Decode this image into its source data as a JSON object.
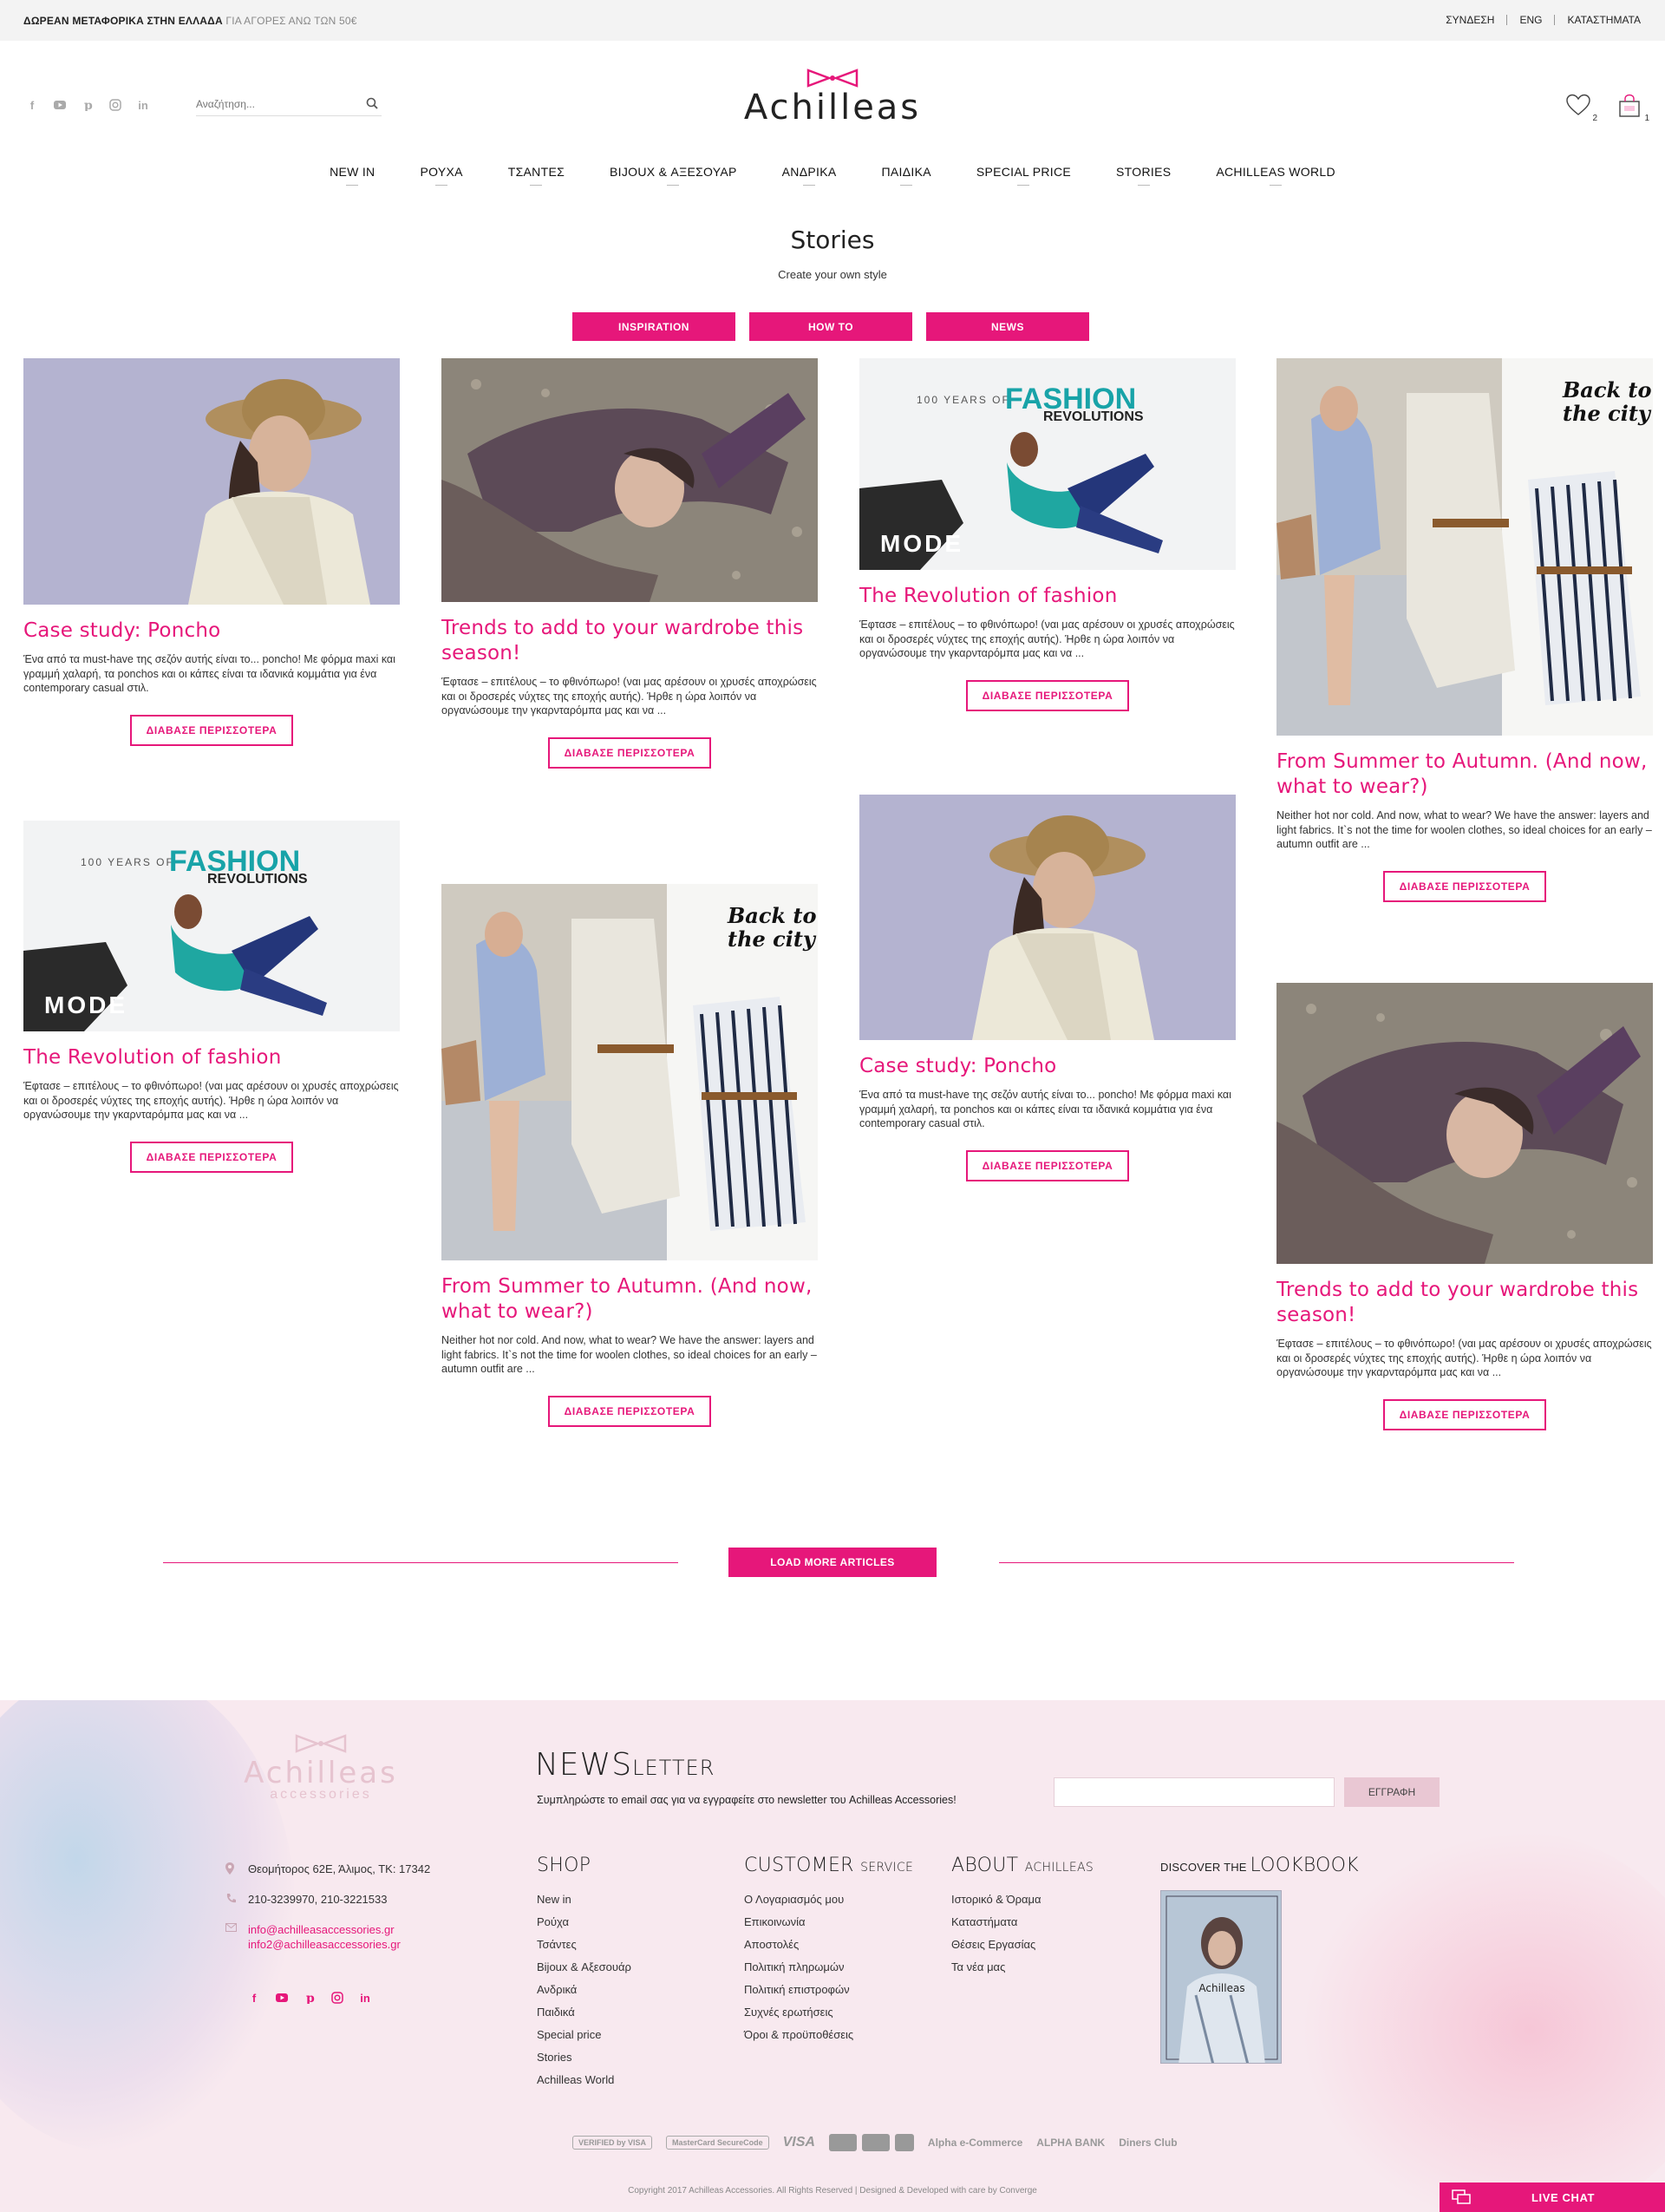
{
  "topbar": {
    "promo_bold": "ΔΩΡΕΑΝ ΜΕΤΑΦΟΡΙΚΑ ΣΤΗΝ ΕΛΛΑΔΑ",
    "promo_light": "ΓΙΑ ΑΓΟΡΕΣ ΑΝΩ ΤΩΝ 50€",
    "links": [
      "ΣΥΝΔΕΣΗ",
      "ENG",
      "ΚΑΤΑΣΤΗΜΑΤΑ"
    ]
  },
  "header": {
    "search_placeholder": "Αναζήτηση...",
    "logo_text": "Achilleas",
    "wishlist_count": "2",
    "cart_count": "1"
  },
  "nav": [
    "NEW IN",
    "ΡΟΥΧΑ",
    "ΤΣΑΝΤΕΣ",
    "BIJOUX & ΑΞΕΣΟΥΑΡ",
    "ΑΝΔΡΙΚΑ",
    "ΠΑΙΔΙΚΑ",
    "SPECIAL PRICE",
    "STORIES",
    "ACHILLEAS WORLD"
  ],
  "stories": {
    "title": "Stories",
    "subtitle": "Create your own style",
    "filters": [
      "INSPIRATION",
      "HOW TO",
      "NEWS"
    ],
    "read_more": "ΔΙΑΒΑΣΕ ΠΕΡΙΣΣΟΤΕΡΑ",
    "load_more": "LOAD MORE ARTICLES"
  },
  "articles": [
    {
      "title": "Case study: Poncho",
      "text": "Ένα από τα must-have της σεζόν αυτής είναι το... poncho! Με φόρμα maxi και γραμμή χαλαρή, τα ponchos και οι κάπες είναι τα ιδανικά κομμάτια για ένα contemporary casual στιλ."
    },
    {
      "title": "Trends to add to your wardrobe this season!",
      "text": "Έφτασε – επιτέλους – το φθινόπωρο! (ναι μας αρέσουν οι χρυσές αποχρώσεις και οι δροσερές νύχτες της εποχής αυτής). Ήρθε η ώρα λοιπόν να οργανώσουμε την γκαρνταρόμπα μας και να ..."
    },
    {
      "title": "The Revolution of fashion",
      "text": "Έφτασε – επιτέλους – το φθινόπωρο! (ναι μας αρέσουν οι χρυσές αποχρώσεις και οι δροσερές νύχτες της εποχής αυτής). Ήρθε η ώρα λοιπόν να οργανώσουμε την γκαρνταρόμπα μας και να ..."
    },
    {
      "title": "From Summer to Autumn. (And now, what to wear?)",
      "text": "Neither hot nor cold. And now, what to wear? We have the answer: layers and light fabrics. It`s not the time for woolen clothes, so ideal choices for an early – autumn outfit are ..."
    },
    {
      "title": "The Revolution of fashion",
      "text": "Έφτασε – επιτέλους – το φθινόπωρο! (ναι μας αρέσουν οι χρυσές αποχρώσεις και οι δροσερές νύχτες της εποχής αυτής). Ήρθε η ώρα λοιπόν να οργανώσουμε την γκαρνταρόμπα μας και να ..."
    },
    {
      "title": "From Summer to Autumn. (And now, what to wear?)",
      "text": "Neither hot nor cold. And now, what to wear? We have the answer: layers and light fabrics. It`s not the time for woolen clothes, so ideal choices for an early – autumn outfit are ..."
    },
    {
      "title": "Case study: Poncho",
      "text": "Ένα από τα must-have της σεζόν αυτής είναι το... poncho! Με φόρμα maxi και γραμμή χαλαρή, τα ponchos και οι κάπες είναι τα ιδανικά κομμάτια για ένα contemporary casual στιλ."
    },
    {
      "title": "Trends to add to your wardrobe this season!",
      "text": "Έφτασε – επιτέλους – το φθινόπωρο! (ναι μας αρέσουν οι χρυσές αποχρώσεις και οι δροσερές νύχτες της εποχής αυτής). Ήρθε η ώρα λοιπόν να οργανώσουμε την γκαρνταρόμπα μας και να ..."
    }
  ],
  "image_text": {
    "mode_line1": "100 YEARS OF",
    "mode_big": "FASHION",
    "mode_big2": "REVOLUTIONS",
    "mode_tag": "MODE",
    "city_line1": "Back to",
    "city_line2": "the city"
  },
  "footer": {
    "logo_word": "Achilleas",
    "logo_sub": "accessories",
    "newsletter_big": "NEWS",
    "newsletter_small": "LETTER",
    "newsletter_text": "Συμπληρώστε το email σας για να εγγραφείτε στο newsletter του Achilleas Accessories!",
    "newsletter_button": "ΕΓΓΡΑΦΗ",
    "address": "Θεομήτορος 62Ε, Άλιμος, ΤΚ: 17342",
    "phones": "210-3239970, 210-3221533",
    "email1": "info@achilleasaccessories.gr",
    "email2": "info2@achilleasaccessories.gr",
    "shop": {
      "title": "SHOP",
      "items": [
        "New in",
        "Ρούχα",
        "Τσάντες",
        "Bijoux & Αξεσουάρ",
        "Ανδρικά",
        "Παιδικά",
        "Special price",
        "Stories",
        "Achilleas World"
      ]
    },
    "customer": {
      "title_big": "CUSTOMER",
      "title_small": "SERVICE",
      "items": [
        "Ο Λογαριασμός μου",
        "Επικοινωνία",
        "Αποστολές",
        "Πολιτική πληρωμών",
        "Πολιτική επιστροφών",
        "Συχνές ερωτήσεις",
        "Όροι & προϋποθέσεις"
      ]
    },
    "about": {
      "title_big": "ABOUT",
      "title_small": "ACHILLEAS",
      "items": [
        "Ιστορικό & Όραμα",
        "Καταστήματα",
        "Θέσεις Εργασίας",
        "Τα νέα μας"
      ]
    },
    "lookbook": {
      "small": "DISCOVER THE",
      "big": "LOOKBOOK",
      "cover_text": "Achilleas"
    },
    "payments": [
      "VERIFIED by VISA",
      "MasterCard SecureCode",
      "VISA",
      "Alpha e-Commerce",
      "ALPHA BANK",
      "Diners Club"
    ],
    "copyright": "Copyright 2017 Achilleas Accessories. All Rights Reserved  |  Designed & Developed with care by Converge",
    "live_chat": "LIVE CHAT"
  },
  "colors": {
    "accent": "#e6177a",
    "footer_bg": "#f8e9ef"
  }
}
